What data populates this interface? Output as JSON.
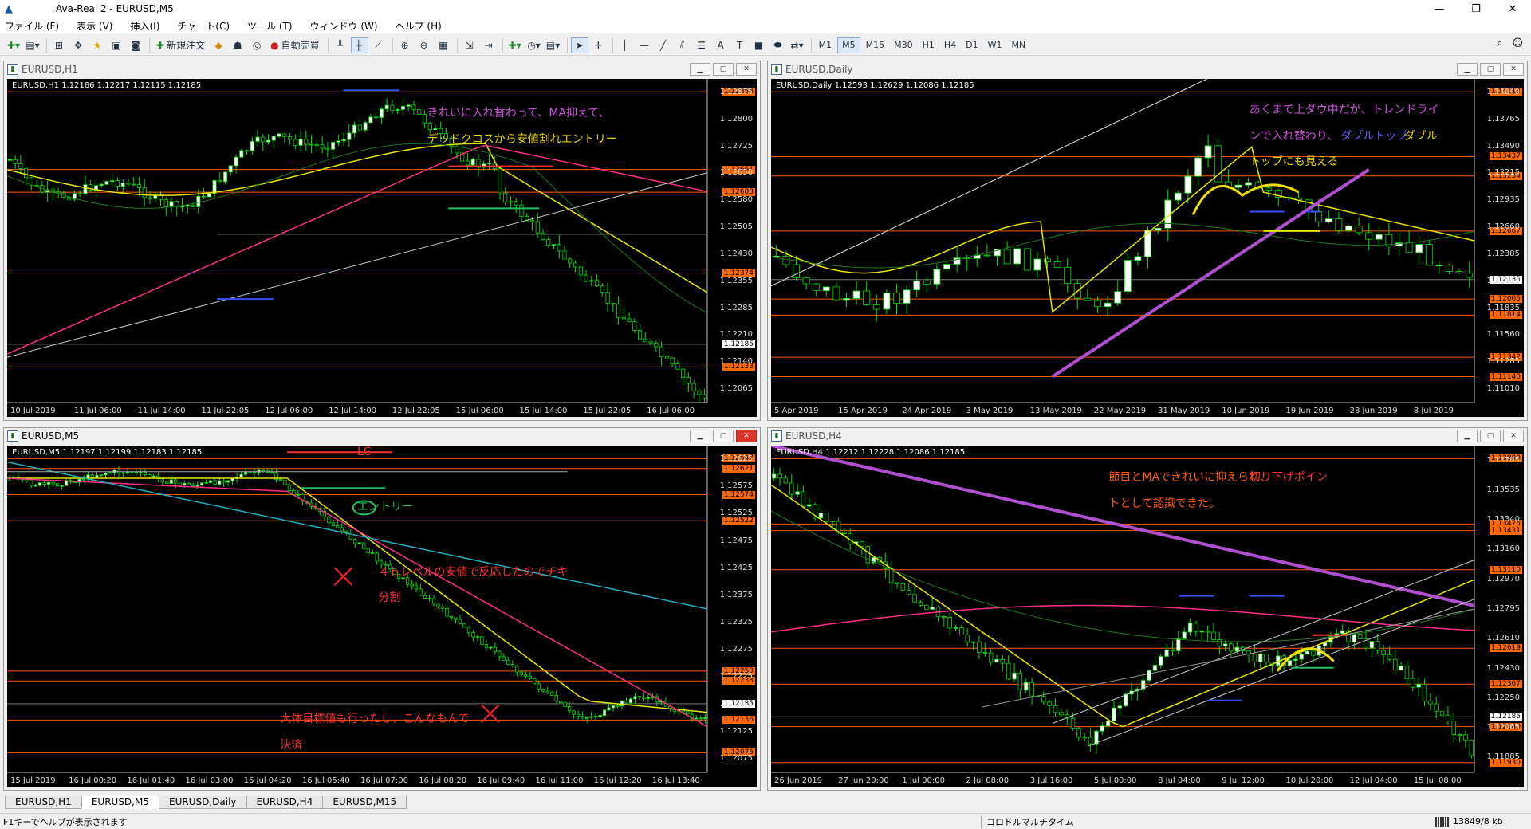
{
  "titlebar": {
    "title": "Ava-Real 2 - EURUSD,M5"
  },
  "menu": [
    "ファイル (F)",
    "表示 (V)",
    "挿入(I)",
    "チャート(C)",
    "ツール (T)",
    "ウィンドウ (W)",
    "ヘルプ (H)"
  ],
  "toolbar": {
    "new_order": "新規注文",
    "auto_trade": "自動売買",
    "timeframes": [
      "M1",
      "M5",
      "M15",
      "M30",
      "H1",
      "H4",
      "D1",
      "W1",
      "MN"
    ],
    "selected_timeframe": "M5"
  },
  "windows": {
    "h1": {
      "title": "EURUSD,H1",
      "info": "EURUSD,H1  1.12186 1.12217 1.12115 1.12185",
      "yticks": [
        "1.12875",
        "1.12800",
        "1.12725",
        "1.12650",
        "1.12580",
        "1.12505",
        "1.12430",
        "1.12355",
        "1.12285",
        "1.12210",
        "1.12140",
        "1.12065"
      ],
      "tags": [
        {
          "t": "1.12854",
          "c": "#ff6a00"
        },
        {
          "t": "1.12661",
          "c": "#ff6a00"
        },
        {
          "t": "1.12608",
          "c": "#ff6a00"
        },
        {
          "t": "1.12374",
          "c": "#ff6a00"
        },
        {
          "t": "1.12185",
          "c": "#ffffff"
        },
        {
          "t": "1.12133",
          "c": "#ff6a00"
        }
      ],
      "xticks": [
        "10 Jul 2019",
        "11 Jul 06:00",
        "11 Jul 14:00",
        "11 Jul 22:05",
        "12 Jul 06:00",
        "12 Jul 14:00",
        "12 Jul 22:05",
        "15 Jul 06:00",
        "15 Jul 14:00",
        "15 Jul 22:05",
        "16 Jul 06:00"
      ],
      "note1": "きれいに入れ替わって、MA抑えて、",
      "note2": "デッドクロスから安値割れエントリー"
    },
    "daily": {
      "title": "EURUSD,Daily",
      "info": "EURUSD,Daily  1.12593 1.12629 1.12086 1.12185",
      "yticks": [
        "1.14040",
        "1.13765",
        "1.13490",
        "1.13215",
        "1.12935",
        "1.12660",
        "1.12385",
        "1.12110",
        "1.11835",
        "1.11560",
        "1.11285",
        "1.11010"
      ],
      "tags": [
        {
          "t": "1.14113",
          "c": "#ff6a00"
        },
        {
          "t": "1.13437",
          "c": "#ff6a00"
        },
        {
          "t": "1.13234",
          "c": "#ff6a00"
        },
        {
          "t": "1.12667",
          "c": "#ff6a00"
        },
        {
          "t": "1.12185",
          "c": "#ffffff"
        },
        {
          "t": "1.12005",
          "c": "#ff6a00"
        },
        {
          "t": "1.11814",
          "c": "#ff6a00"
        },
        {
          "t": "1.11342",
          "c": "#ff6a00"
        },
        {
          "t": "1.11140",
          "c": "#ff6a00"
        }
      ],
      "xticks": [
        "5 Apr 2019",
        "15 Apr 2019",
        "24 Apr 2019",
        "3 May 2019",
        "13 May 2019",
        "22 May 2019",
        "31 May 2019",
        "10 Jun 2019",
        "19 Jun 2019",
        "28 Jun 2019",
        "8 Jul 2019"
      ],
      "note1": "あくまで上ダウ中だが、トレンドライ",
      "note2a": "ンで入れ替わり、",
      "note2b": "ダブルトップ",
      "note2c": "ダブル",
      "note3": "トップにも見える"
    },
    "m5": {
      "title": "EURUSD,M5",
      "info": "EURUSD,M5  1.12197 1.12199 1.12183 1.12185",
      "yticks": [
        "1.12625",
        "1.12575",
        "1.12525",
        "1.12475",
        "1.12425",
        "1.12375",
        "1.12325",
        "1.12275",
        "1.12225",
        "1.12175",
        "1.12125",
        "1.12075"
      ],
      "tags": [
        {
          "t": "1.12647",
          "c": "#ff6a00"
        },
        {
          "t": "1.12621",
          "c": "#ff6a00"
        },
        {
          "t": "1.12574",
          "c": "#ff6a00"
        },
        {
          "t": "1.12522",
          "c": "#ff6a00"
        },
        {
          "t": "1.12250",
          "c": "#ff6a00"
        },
        {
          "t": "1.12233",
          "c": "#ff6a00"
        },
        {
          "t": "1.12185",
          "c": "#ffffff"
        },
        {
          "t": "1.12136",
          "c": "#ff6a00"
        },
        {
          "t": "1.12076",
          "c": "#ff6a00"
        }
      ],
      "xticks": [
        "15 Jul 2019",
        "16 Jul 00:20",
        "16 Jul 01:40",
        "16 Jul 03:00",
        "16 Jul 04:20",
        "16 Jul 05:40",
        "16 Jul 07:00",
        "16 Jul 08:20",
        "16 Jul 09:40",
        "16 Jul 11:00",
        "16 Jul 12:20",
        "16 Jul 13:40"
      ],
      "note_lc": "LC",
      "note_entry": "エントリー",
      "note_4h1": "４ｈレベルの安値で反応したのでチキ",
      "note_4h2": "分割",
      "note_exit1": "大体目標値も行ったし、こんなもんで",
      "note_exit2": "決済"
    },
    "h4": {
      "title": "EURUSD,H4",
      "info": "EURUSD,H4  1.12212 1.12228 1.12086 1.12185",
      "yticks": [
        "1.13705",
        "1.13535",
        "1.13340",
        "1.13160",
        "1.12970",
        "1.12795",
        "1.12610",
        "1.12430",
        "1.12250",
        "1.12065",
        "1.11885"
      ],
      "tags": [
        {
          "t": "1.13809",
          "c": "#ff6a00"
        },
        {
          "t": "1.13475",
          "c": "#ff6a00"
        },
        {
          "t": "1.13431",
          "c": "#ff6a00"
        },
        {
          "t": "1.13110",
          "c": "#ff6a00"
        },
        {
          "t": "1.12619",
          "c": "#ff6a00"
        },
        {
          "t": "1.12367",
          "c": "#ff6a00"
        },
        {
          "t": "1.12185",
          "c": "#ffffff"
        },
        {
          "t": "1.12140",
          "c": "#ff6a00"
        },
        {
          "t": "1.11930",
          "c": "#ff6a00"
        }
      ],
      "xticks": [
        "26 Jun 2019",
        "27 Jun 20:00",
        "1 Jul 00:00",
        "2 Jul 08:00",
        "3 Jul 16:00",
        "5 Jul 00:00",
        "8 Jul 04:00",
        "9 Jul 12:00",
        "10 Jul 20:00",
        "12 Jul 04:00",
        "15 Jul 08:00"
      ],
      "note1a": "節目とMAできれいに抑えられ、",
      "note1b": "切り下げポイン",
      "note2": "トとして認識できた。"
    }
  },
  "tabs": [
    "EURUSD,H1",
    "EURUSD,M5",
    "EURUSD,Daily",
    "EURUSD,H4",
    "EURUSD,M15"
  ],
  "selected_tab": "EURUSD,M5",
  "status": {
    "help": "F1キーでヘルプが表示されます",
    "profile": "コロドルマルチタイム",
    "traffic": "13849/8 kb"
  }
}
